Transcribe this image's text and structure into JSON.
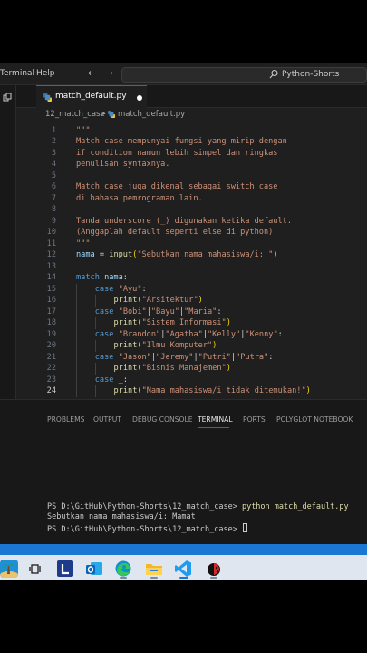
{
  "menu": {
    "terminal": "Terminal",
    "help": "Help"
  },
  "nav": {
    "back": "←",
    "forward": "→"
  },
  "command_center": {
    "label": "Python-Shorts"
  },
  "tab": {
    "label": "match_default.py"
  },
  "breadcrumb": {
    "folder": "12_match_case",
    "separator": ">",
    "file": "match_default.py"
  },
  "editor": {
    "active_line": "24",
    "lines": [
      {
        "n": "1",
        "text": "\"\"\""
      },
      {
        "n": "2",
        "text": "Match case mempunyai fungsi yang mirip dengan"
      },
      {
        "n": "3",
        "text": "if condition namun lebih simpel dan ringkas"
      },
      {
        "n": "4",
        "text": "penulisan syntaxnya."
      },
      {
        "n": "5",
        "text": ""
      },
      {
        "n": "6",
        "text": "Match case juga dikenal sebagai switch case"
      },
      {
        "n": "7",
        "text": "di bahasa pemrograman lain."
      },
      {
        "n": "8",
        "text": ""
      },
      {
        "n": "9",
        "text": "Tanda underscore (_) digunakan ketika default."
      },
      {
        "n": "10",
        "text": "(Anggaplah default seperti else di python)"
      },
      {
        "n": "11",
        "text": "\"\"\""
      },
      {
        "n": "12",
        "text": "nama = input(\"Sebutkan nama mahasiswa/i: \")"
      },
      {
        "n": "13",
        "text": ""
      },
      {
        "n": "14",
        "text": "match nama:"
      },
      {
        "n": "15",
        "text": "    case \"Ayu\":"
      },
      {
        "n": "16",
        "text": "        print(\"Arsitektur\")"
      },
      {
        "n": "17",
        "text": "    case \"Bobi\"|\"Bayu\"|\"Maria\":"
      },
      {
        "n": "18",
        "text": "        print(\"Sistem Informasi\")"
      },
      {
        "n": "19",
        "text": "    case \"Brandon\"|\"Agatha\"|\"Kelly\"|\"Kenny\":"
      },
      {
        "n": "20",
        "text": "        print(\"Ilmu Komputer\")"
      },
      {
        "n": "21",
        "text": "    case \"Jason\"|\"Jeremy\"|\"Putri\"|\"Putra\":"
      },
      {
        "n": "22",
        "text": "        print(\"Bisnis Manajemen\")"
      },
      {
        "n": "23",
        "text": "    case _:"
      },
      {
        "n": "24",
        "text": "        print(\"Nama mahasiswa/i tidak ditemukan!\")"
      }
    ]
  },
  "panel": {
    "tabs": [
      "PROBLEMS",
      "OUTPUT",
      "DEBUG CONSOLE",
      "TERMINAL",
      "PORTS",
      "POLYGLOT NOTEBOOK"
    ],
    "active_tab": "TERMINAL"
  },
  "terminal": {
    "prompt": "PS D:\\GitHub\\Python-Shorts\\12_match_case>",
    "command": "python match_default.py",
    "output": "Sebutkan nama mahasiswa/i: Mamat",
    "prompt2": "PS D:\\GitHub\\Python-Shorts\\12_match_case>"
  },
  "taskbar": {
    "icons": [
      "landscape-widget-icon",
      "task-view-icon",
      "l-app-icon",
      "outlook-icon",
      "edge-icon",
      "file-explorer-icon",
      "vscode-icon",
      "ladybug-app-icon"
    ],
    "accent": "#1a78d3",
    "background": "#dfe6ef"
  },
  "colors": {
    "editor_bg": "#1f1f1f",
    "string": "#ce9178",
    "keyword": "#569cd6",
    "function": "#dcdcaa",
    "variable": "#9cdcfe",
    "accent": "#0078d4"
  }
}
